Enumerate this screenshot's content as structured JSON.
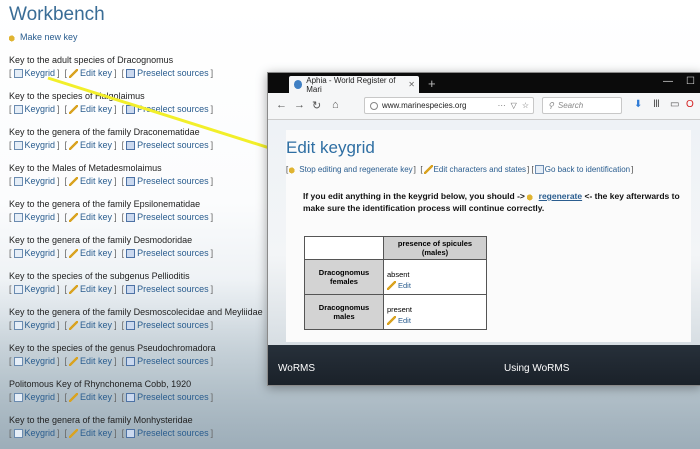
{
  "workbench": {
    "title": "Workbench",
    "make_new_key": "Make new key",
    "link_labels": {
      "keygrid": "Keygrid",
      "edit_key": "Edit key",
      "preselect": "Preselect sources"
    },
    "keys": [
      "Key to the adult species of Dracognomus",
      "Key to the species of Halgolaimus",
      "Key to the genera of the family Draconematidae",
      "Key to the Males of Metadesmolaimus",
      "Key to the genera of the family Epsilonematidae",
      "Key to the genera of the family Desmodoridae",
      "Key to the species of the subgenus Pellioditis",
      "Key to the genera of the family Desmoscolecidae and Meyliidae",
      "Key to the species of the genus Pseudochromadora",
      "Politomous Key of Rhynchonema Cobb, 1920",
      "Key to the genera of the family Monhysteridae"
    ]
  },
  "browser": {
    "tab_title": "Aphia - World Register of Mari",
    "url": "www.marinespecies.org",
    "search_placeholder": "Search"
  },
  "keygrid_page": {
    "title": "Edit keygrid",
    "links": [
      "Stop editing and regenerate key",
      "Edit characters and states",
      "Go back to identification"
    ],
    "warning_pre": "If you edit anything in the keygrid below, you should ->",
    "warning_link": "regenerate",
    "warning_post": "<- the key afterwards to make sure the identification process will continue correctly.",
    "table": {
      "column": "presence of spicules (males)",
      "rows": [
        {
          "label": "Dracognomus females",
          "value": "absent",
          "edit": "Edit"
        },
        {
          "label": "Dracognomus males",
          "value": "present",
          "edit": "Edit"
        }
      ]
    }
  },
  "footer": {
    "left": "WoRMS",
    "right": "Using WoRMS"
  },
  "colors": {
    "title_blue": "#3a6d96",
    "link_blue": "#2a5d8f",
    "arrow_yellow": "#f2ef2a"
  }
}
